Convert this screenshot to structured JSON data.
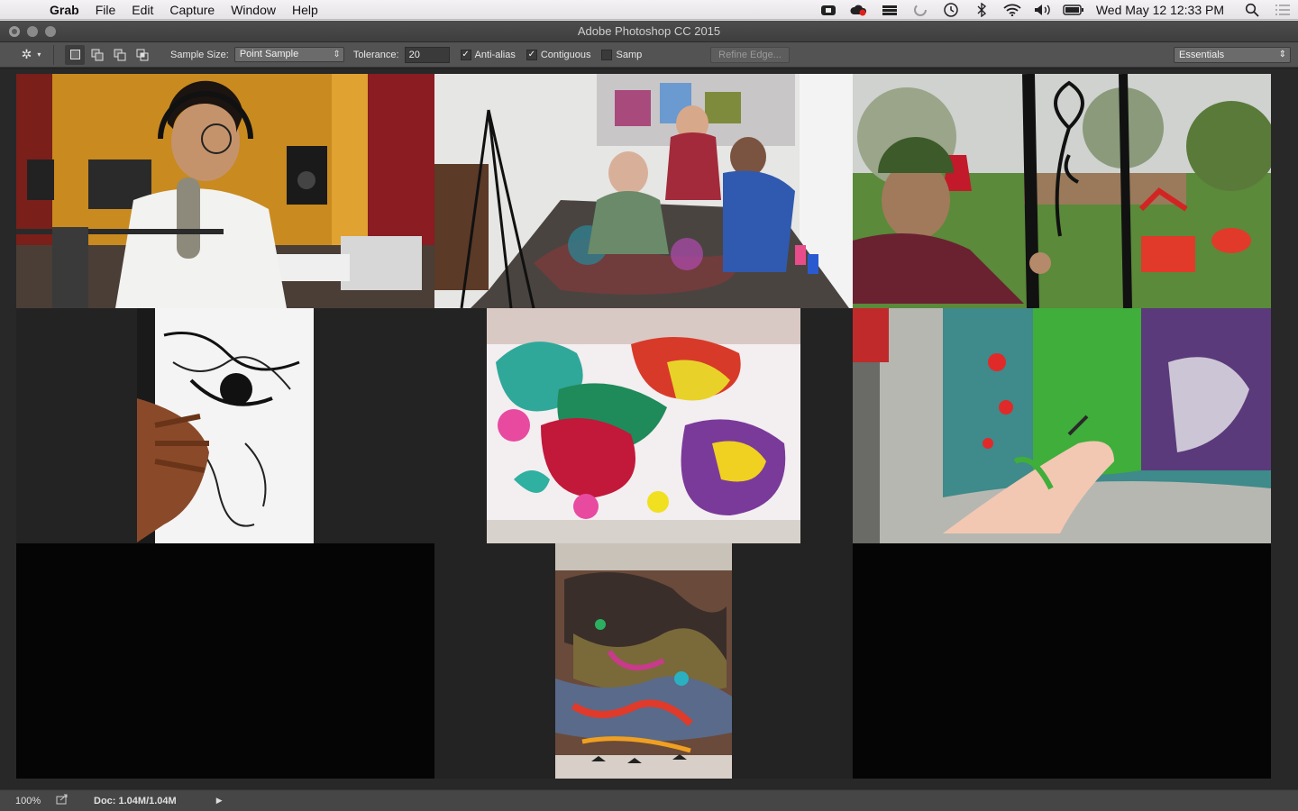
{
  "menubar": {
    "app_name": "Grab",
    "items": [
      "File",
      "Edit",
      "Capture",
      "Window",
      "Help"
    ],
    "clock": "Wed May 12  12:33 PM"
  },
  "window": {
    "title": "Adobe Photoshop CC 2015"
  },
  "options": {
    "sample_size_label": "Sample Size:",
    "sample_size_value": "Point Sample",
    "tolerance_label": "Tolerance:",
    "tolerance_value": "20",
    "antialias_label": "Anti-alias",
    "antialias_checked": true,
    "contiguous_label": "Contiguous",
    "contiguous_checked": true,
    "sample_all_label": "Samp",
    "sample_all_checked": false,
    "refine_edge_label": "Refine Edge...",
    "workspace_value": "Essentials"
  },
  "status": {
    "zoom": "100%",
    "doc_info": "Doc: 1.04M/1.04M"
  },
  "colors": {
    "ps_panel": "#535353",
    "ps_canvas_bg": "#282828",
    "ps_document": "#050505"
  }
}
